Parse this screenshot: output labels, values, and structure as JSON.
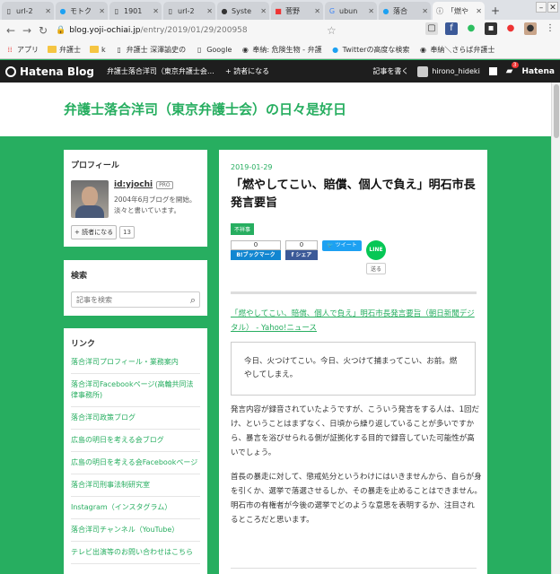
{
  "tabs": [
    {
      "label": "url-2",
      "icon": "doc-icon"
    },
    {
      "label": "モトク",
      "icon": "twitter-icon"
    },
    {
      "label": "1901",
      "icon": "doc-icon"
    },
    {
      "label": "url-2",
      "icon": "doc-icon"
    },
    {
      "label": "Syste",
      "icon": "github-icon"
    },
    {
      "label": "菅野",
      "icon": "app-icon"
    },
    {
      "label": "ubun",
      "icon": "google-icon"
    },
    {
      "label": "落合",
      "icon": "twitter-icon"
    },
    {
      "label": "「燃や",
      "icon": "info-icon",
      "active": true
    }
  ],
  "addressbar": {
    "host": "blog.yoji-ochiai.jp",
    "path": "/entry/2019/01/29/200958"
  },
  "bookmarks": [
    {
      "label": "アプリ",
      "icon": "apps-icon"
    },
    {
      "label": "弁護士",
      "icon": "folder-icon"
    },
    {
      "label": "k",
      "icon": "folder-icon"
    },
    {
      "label": "弁護士 深澤諭史の",
      "icon": "doc-icon"
    },
    {
      "label": "Google",
      "icon": "doc-icon"
    },
    {
      "label": "奉納: 危険生物 - 弁護",
      "icon": "hatena-icon"
    },
    {
      "label": "Twitterの高度な検索",
      "icon": "twitter-icon"
    },
    {
      "label": "奉納＼さらば弁護士",
      "icon": "hatena-icon"
    }
  ],
  "hatena": {
    "logo": "Hatena Blog",
    "blog_menu": "弁護士落合洋司（東京弁護士会…",
    "subscribe": "読者になる",
    "write": "記事を書く",
    "user": "hirono_hideki",
    "notif_count": "3",
    "brand": "Hatena"
  },
  "blog": {
    "title": "弁護士落合洋司（東京弁護士会）の日々是好日"
  },
  "profile": {
    "heading": "プロフィール",
    "id": "id:yjochi",
    "badge": "PRO",
    "desc": "2004年6月ブログを開始。淡々と書いています。",
    "reader_btn": "読者になる",
    "reader_count": "13"
  },
  "search": {
    "heading": "検索",
    "placeholder": "記事を検索"
  },
  "links": {
    "heading": "リンク",
    "items": [
      "落合洋司プロフィール・業務案内",
      "落合洋司Facebookページ(高輪共同法律事務所)",
      "落合洋司政策ブログ",
      "広島の明日を考える会ブログ",
      "広島の明日を考える会Facebookページ",
      "落合洋司刑事法制研究室",
      "Instagram（インスタグラム）",
      "落合洋司チャンネル（YouTube）",
      "テレビ出演等のお問い合わせはこちら"
    ]
  },
  "article": {
    "date": "2019-01-29",
    "title": "「燃やしてこい、賠償、個人で負え」明石市長発言要旨",
    "category": "不祥事",
    "share": {
      "hatena_count": "0",
      "hatena_label": "B!ブックマーク",
      "fb_count": "0",
      "fb_label": "シェア",
      "tweet_label": "ツイート",
      "line_label": "LINE",
      "line_send": "送る"
    },
    "source_link": "「燃やしてこい、賠償、個人で負え」明石市長発言要旨（朝日新聞デジタル） - Yahoo!ニュース",
    "quote": "今日、火つけてこい。今日、火つけて捕まってこい、お前。燃やしてしまえ。",
    "para1": "発言内容が録音されていたようですが、こういう発言をする人は、1回だけ、ということはまずなく、日頃から繰り返していることが多いですから、暴言を浴びせられる側が証拠化する目的で録音していた可能性が高いでしょう。",
    "para2": "首長の暴走に対して、懲戒処分というわけにはいきませんから、自らが身を引くか、選挙で落選させるしか、その暴走を止めることはできません。明石市の有権者が今後の選挙でどのような意思を表明するか、注目されるところだと思います。"
  }
}
